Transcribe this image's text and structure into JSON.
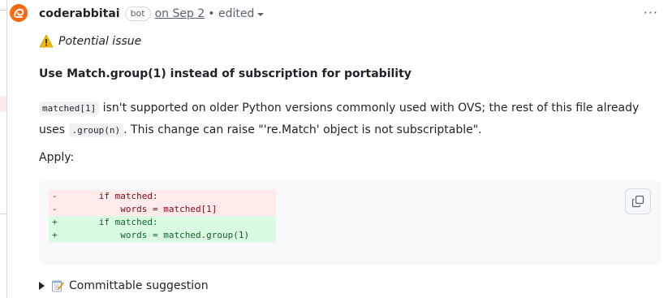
{
  "comment": {
    "author": "coderabbitai",
    "badge": "bot",
    "date": "on Sep 2",
    "edited": "• edited",
    "more_menu": "···"
  },
  "issue": {
    "label": "Potential issue"
  },
  "title": "Use Match.group(1) instead of subscription for portability",
  "paragraph": {
    "code1": "matched[1]",
    "text1": " isn't supported on older Python versions commonly used with OVS; the rest of this file already uses ",
    "code2": ".group(n)",
    "text2": ". This change can raise \"'re.Match' object is not subscriptable\"."
  },
  "apply_label": "Apply:",
  "diff": [
    {
      "sign": "-",
      "code": "      if matched:"
    },
    {
      "sign": "-",
      "code": "          words = matched[1]"
    },
    {
      "sign": "+",
      "code": "      if matched:"
    },
    {
      "sign": "+",
      "code": "          words = matched.group(1)"
    }
  ],
  "suggestion": {
    "label": "Committable suggestion"
  },
  "colors": {
    "accent": "#ff6a13",
    "del_bg": "#ffebe9",
    "add_bg": "#dafbe1"
  },
  "icons": {
    "avatar": "coderabbit-avatar-icon",
    "warning": "warning-icon",
    "copy": "copy-icon",
    "memo": "memo-icon",
    "expand": "triangle-right-icon"
  }
}
